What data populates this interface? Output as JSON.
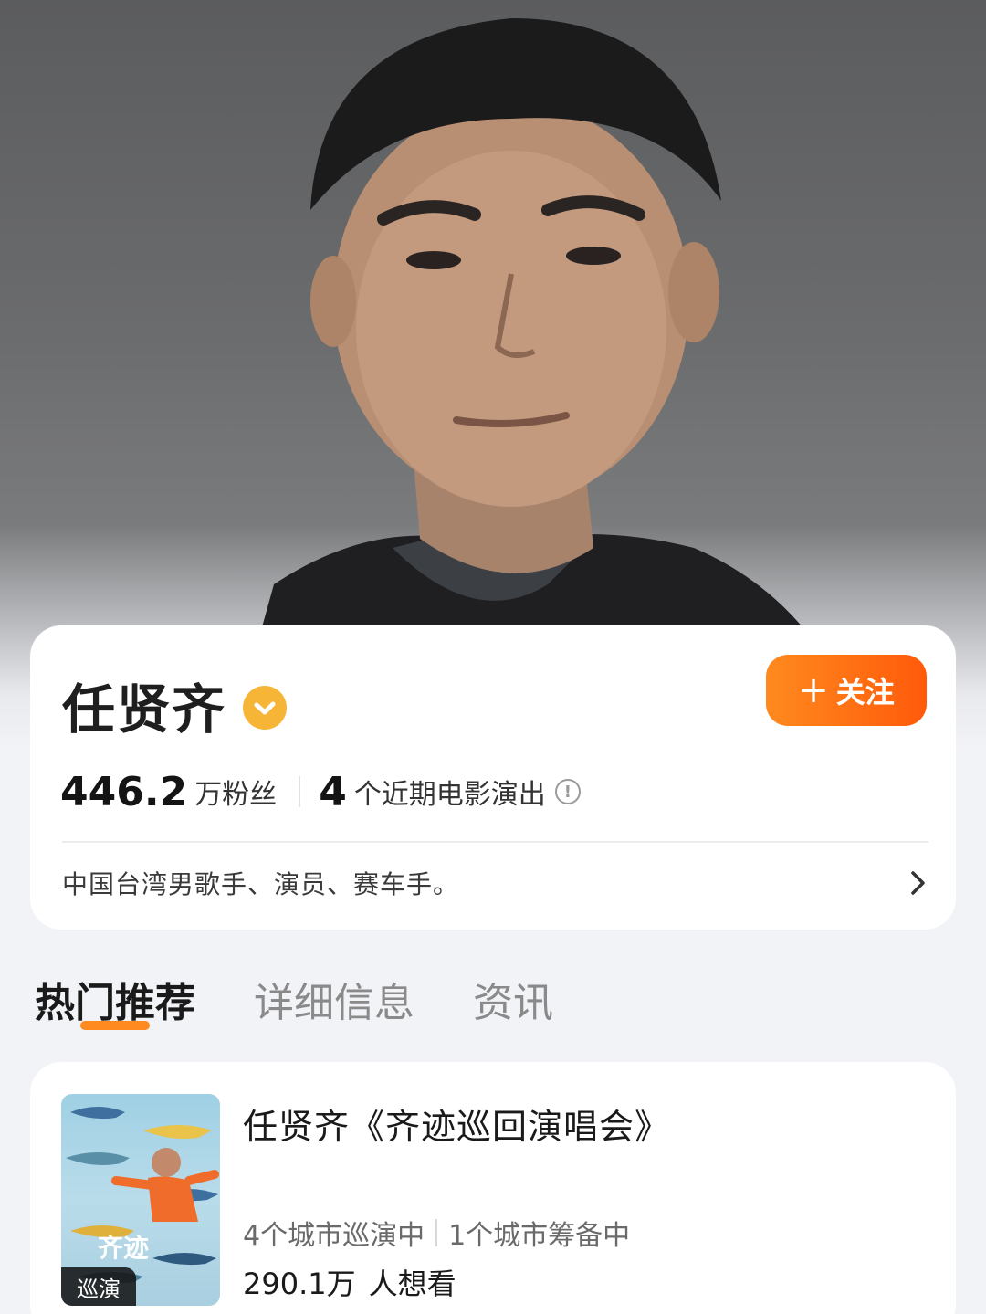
{
  "profile": {
    "name": "任贤齐",
    "follow_label": "关注",
    "fans_count": "446.2",
    "fans_label": "万粉丝",
    "shows_count": "4",
    "shows_label": "个近期电影演出",
    "bio": "中国台湾男歌手、演员、赛车手。"
  },
  "tabs": [
    {
      "label": "热门推荐",
      "active": true
    },
    {
      "label": "详细信息",
      "active": false
    },
    {
      "label": "资讯",
      "active": false
    }
  ],
  "event": {
    "title": "任贤齐《齐迹巡回演唱会》",
    "poster_badge": "巡演",
    "touring_cities": "4个城市巡演中",
    "preparing_cities": "1个城市筹备中",
    "interest_count": "290.1万",
    "interest_label": "人想看"
  },
  "colors": {
    "accent_orange": "#ff6a10",
    "verified_badge": "#f7b538",
    "tab_underline": "#ff8a1f"
  }
}
